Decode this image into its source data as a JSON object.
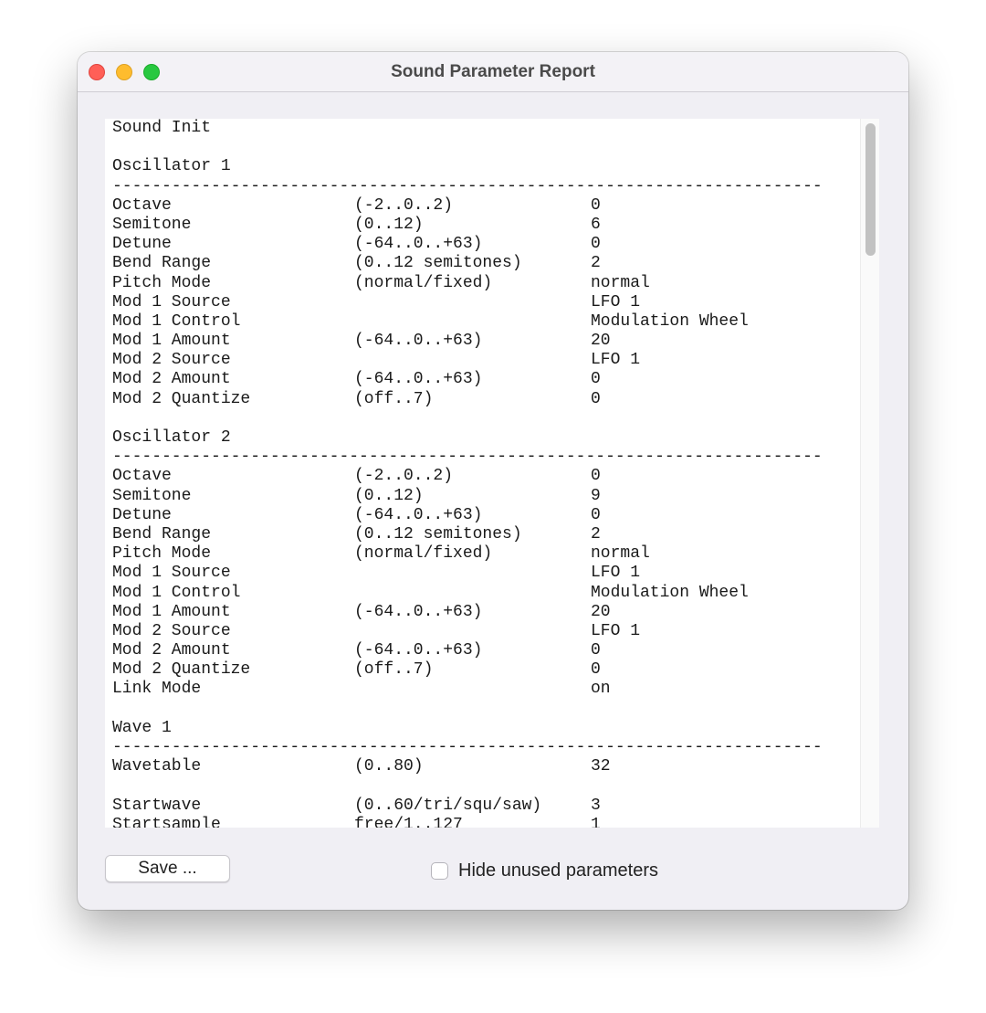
{
  "window": {
    "title": "Sound Parameter Report"
  },
  "report": {
    "lines": [
      {
        "type": "title",
        "text": "Sound Init"
      },
      {
        "type": "blank"
      },
      {
        "type": "header",
        "text": "Oscillator 1"
      },
      {
        "type": "rule",
        "text": "------------------------------------------------------------------------"
      },
      {
        "type": "param",
        "name": "Octave",
        "range": "(-2..0..2)",
        "value": "0"
      },
      {
        "type": "param",
        "name": "Semitone",
        "range": "(0..12)",
        "value": "6"
      },
      {
        "type": "param",
        "name": "Detune",
        "range": "(-64..0..+63)",
        "value": "0"
      },
      {
        "type": "param",
        "name": "Bend Range",
        "range": "(0..12 semitones)",
        "value": "2"
      },
      {
        "type": "param",
        "name": "Pitch Mode",
        "range": "(normal/fixed)",
        "value": "normal"
      },
      {
        "type": "param",
        "name": "Mod 1 Source",
        "range": "",
        "value": "LFO 1"
      },
      {
        "type": "param",
        "name": "Mod 1 Control",
        "range": "",
        "value": "Modulation Wheel"
      },
      {
        "type": "param",
        "name": "Mod 1 Amount",
        "range": "(-64..0..+63)",
        "value": "20"
      },
      {
        "type": "param",
        "name": "Mod 2 Source",
        "range": "",
        "value": "LFO 1"
      },
      {
        "type": "param",
        "name": "Mod 2 Amount",
        "range": "(-64..0..+63)",
        "value": "0"
      },
      {
        "type": "param",
        "name": "Mod 2 Quantize",
        "range": "(off..7)",
        "value": "0"
      },
      {
        "type": "blank"
      },
      {
        "type": "header",
        "text": "Oscillator 2"
      },
      {
        "type": "rule",
        "text": "------------------------------------------------------------------------"
      },
      {
        "type": "param",
        "name": "Octave",
        "range": "(-2..0..2)",
        "value": "0"
      },
      {
        "type": "param",
        "name": "Semitone",
        "range": "(0..12)",
        "value": "9"
      },
      {
        "type": "param",
        "name": "Detune",
        "range": "(-64..0..+63)",
        "value": "0"
      },
      {
        "type": "param",
        "name": "Bend Range",
        "range": "(0..12 semitones)",
        "value": "2"
      },
      {
        "type": "param",
        "name": "Pitch Mode",
        "range": "(normal/fixed)",
        "value": "normal"
      },
      {
        "type": "param",
        "name": "Mod 1 Source",
        "range": "",
        "value": "LFO 1"
      },
      {
        "type": "param",
        "name": "Mod 1 Control",
        "range": "",
        "value": "Modulation Wheel"
      },
      {
        "type": "param",
        "name": "Mod 1 Amount",
        "range": "(-64..0..+63)",
        "value": "20"
      },
      {
        "type": "param",
        "name": "Mod 2 Source",
        "range": "",
        "value": "LFO 1"
      },
      {
        "type": "param",
        "name": "Mod 2 Amount",
        "range": "(-64..0..+63)",
        "value": "0"
      },
      {
        "type": "param",
        "name": "Mod 2 Quantize",
        "range": "(off..7)",
        "value": "0"
      },
      {
        "type": "param",
        "name": "Link Mode",
        "range": "",
        "value": "on"
      },
      {
        "type": "blank"
      },
      {
        "type": "header",
        "text": "Wave 1"
      },
      {
        "type": "rule",
        "text": "------------------------------------------------------------------------"
      },
      {
        "type": "param",
        "name": "Wavetable",
        "range": "(0..80)",
        "value": "32"
      },
      {
        "type": "blank"
      },
      {
        "type": "param",
        "name": "Startwave",
        "range": "(0..60/tri/squ/saw)",
        "value": "3"
      },
      {
        "type": "param",
        "name": "Startsample",
        "range": "free/1..127",
        "value": "1"
      }
    ]
  },
  "footer": {
    "save_label": "Save ...",
    "hide_unused_label": "Hide unused parameters",
    "hide_unused_checked": false
  }
}
